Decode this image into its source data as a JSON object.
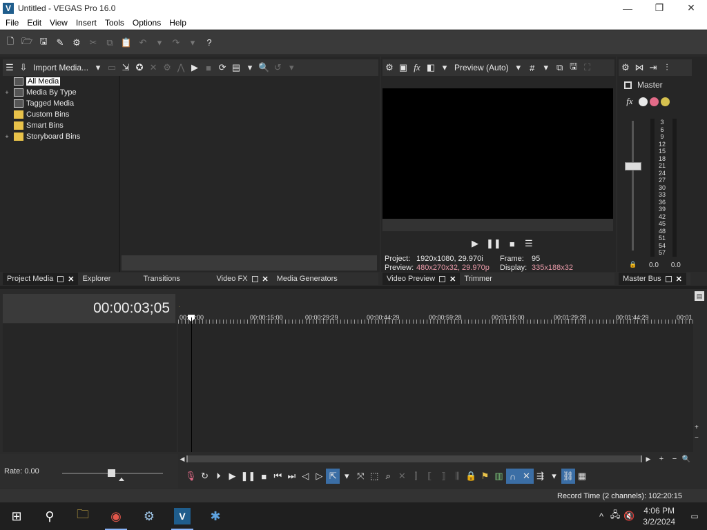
{
  "window": {
    "title": "Untitled - VEGAS Pro 16.0",
    "app_icon_letter": "V",
    "min": "—",
    "max": "❐",
    "close": "✕"
  },
  "menu": [
    "File",
    "Edit",
    "View",
    "Insert",
    "Tools",
    "Options",
    "Help"
  ],
  "project_media": {
    "import_label": "Import Media...",
    "tree": [
      {
        "label": "All Media",
        "expand": "",
        "icon": "media",
        "selected": true
      },
      {
        "label": "Media By Type",
        "expand": "+",
        "icon": "media",
        "selected": false
      },
      {
        "label": "Tagged Media",
        "expand": "",
        "icon": "media",
        "selected": false
      },
      {
        "label": "Custom Bins",
        "expand": "",
        "icon": "folder",
        "selected": false
      },
      {
        "label": "Smart Bins",
        "expand": "",
        "icon": "folder",
        "selected": false
      },
      {
        "label": "Storyboard Bins",
        "expand": "+",
        "icon": "folder",
        "selected": false
      }
    ],
    "tabs": [
      "Project Media",
      "Explorer",
      "Transitions",
      "Video FX",
      "Media Generators"
    ]
  },
  "video_preview": {
    "mode_label": "Preview (Auto)",
    "project_label": "Project:",
    "project_value": "1920x1080, 29.970i",
    "frame_label": "Frame:",
    "frame_value": "95",
    "preview_label": "Preview:",
    "preview_value": "480x270x32, 29.970p",
    "display_label": "Display:",
    "display_value": "335x188x32",
    "tabs": [
      "Video Preview",
      "Trimmer"
    ]
  },
  "master_bus": {
    "label": "Master",
    "scale": [
      "3",
      "6",
      "9",
      "12",
      "15",
      "18",
      "21",
      "24",
      "27",
      "30",
      "33",
      "36",
      "39",
      "42",
      "45",
      "48",
      "51",
      "54",
      "57"
    ],
    "left_value": "0.0",
    "right_value": "0.0",
    "tab": "Master Bus"
  },
  "timeline": {
    "time_display": "00:00:03;05",
    "ruler": [
      "00:00:00",
      "00:00:15:00",
      "00:00:29:29",
      "00:00:44:29",
      "00:00:59:28",
      "00:01:15:00",
      "00:01:29:29",
      "00:01:44:29",
      "00:01"
    ]
  },
  "rate": {
    "label": "Rate: 0.00"
  },
  "status": {
    "record_time": "Record Time (2 channels): 102:20:15"
  },
  "taskbar": {
    "time": "4:06 PM",
    "date": "3/2/2024"
  }
}
